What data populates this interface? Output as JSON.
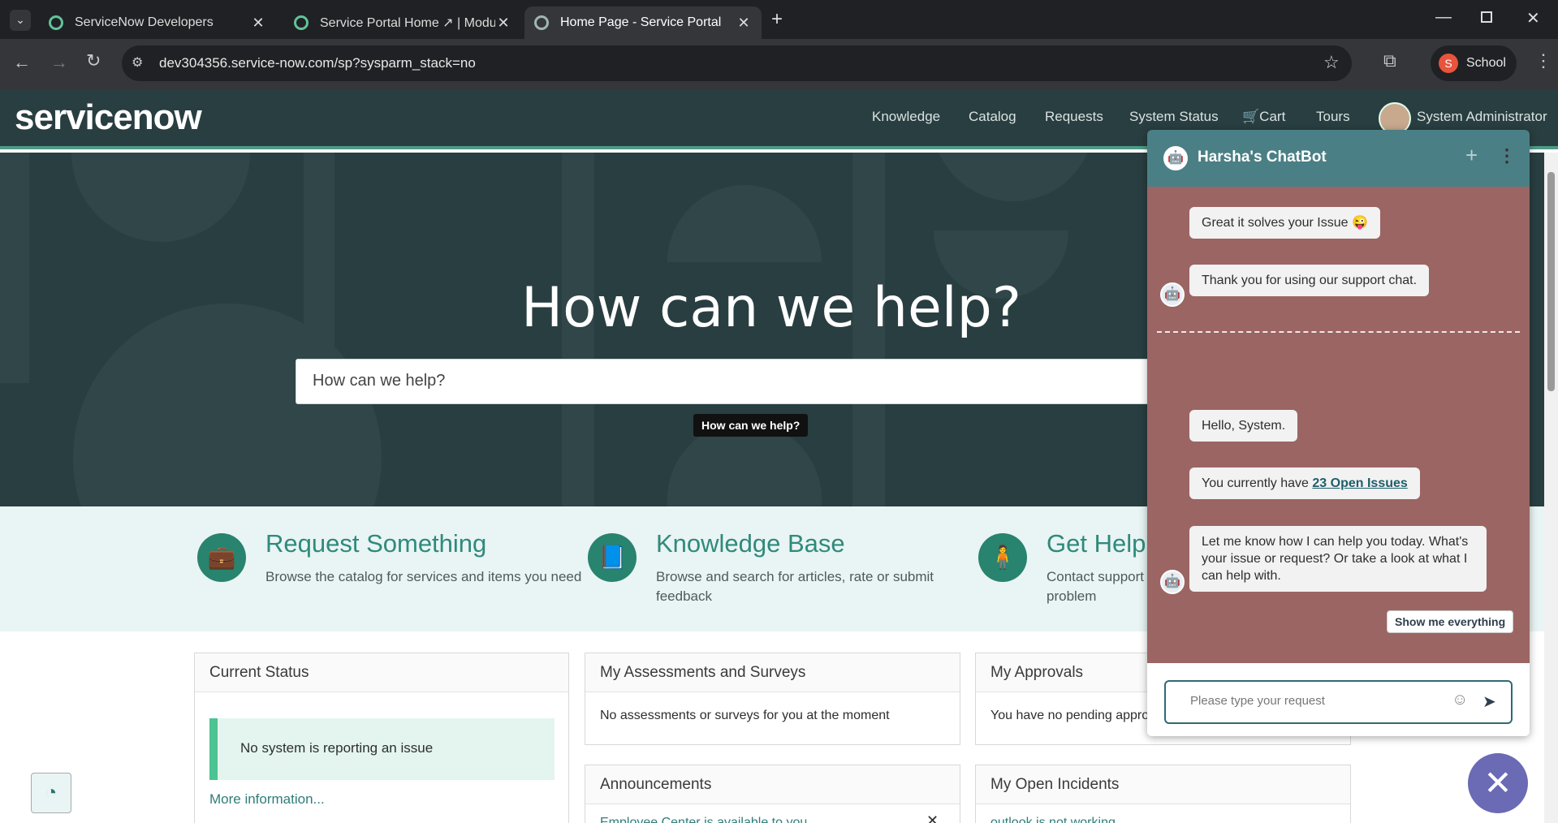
{
  "browser": {
    "tabs": [
      {
        "title": "ServiceNow Developers"
      },
      {
        "title": "Service Portal Home ↗ | Module"
      },
      {
        "title": "Home Page - Service Portal"
      }
    ],
    "new_tab_icon": "+",
    "url": "dev304356.service-now.com/sp?sysparm_stack=no",
    "profile_initial": "S",
    "profile_label": "School"
  },
  "portal": {
    "logo": "servicenow",
    "nav": {
      "knowledge": "Knowledge",
      "catalog": "Catalog",
      "requests": "Requests",
      "system_status": "System Status",
      "cart": "Cart",
      "tours": "Tours",
      "user": "System Administrator"
    },
    "hero_title": "How can we help?",
    "search_placeholder": "How can we help?",
    "search_tooltip": "How can we help?",
    "features": [
      {
        "title": "Request Something",
        "desc": "Browse the catalog for services and items you need",
        "icon": "briefcase-icon"
      },
      {
        "title": "Knowledge Base",
        "desc": "Browse and search for articles, rate or submit feedback",
        "icon": "book-icon"
      },
      {
        "title": "Get Help",
        "desc": "Contact support to make a request, or report a problem",
        "icon": "person-icon"
      }
    ],
    "widgets": {
      "current_status": {
        "title": "Current Status",
        "message": "No system is reporting an issue",
        "link": "More information..."
      },
      "assessments": {
        "title": "My Assessments and Surveys",
        "message": "No assessments or surveys for you at the moment"
      },
      "approvals": {
        "title": "My Approvals",
        "message": "You have no pending approvals"
      },
      "announcements": {
        "title": "Announcements",
        "item": "Employee Center is available to you"
      },
      "incidents": {
        "title": "My Open Incidents",
        "item": "outlook is not working"
      }
    }
  },
  "chatbot": {
    "title": "Harsha's ChatBot",
    "messages": {
      "m1": "Great it solves your Issue 😜",
      "m2": "Thank you for using our support chat.",
      "m3": "Hello, System.",
      "m4_prefix": "You currently have ",
      "m4_link": "23 Open Issues",
      "m5": "Let me know how I can help you today. What's your issue or request? Or take a look at what I can help with."
    },
    "quick_reply": "Show me everything",
    "input_placeholder": "Please type your request"
  },
  "colors": {
    "nav_bg": "#293e40",
    "accent": "#28836f",
    "chat_header": "#4a7f85",
    "chat_body": "#9b6563",
    "fab": "#6a6ab5"
  }
}
